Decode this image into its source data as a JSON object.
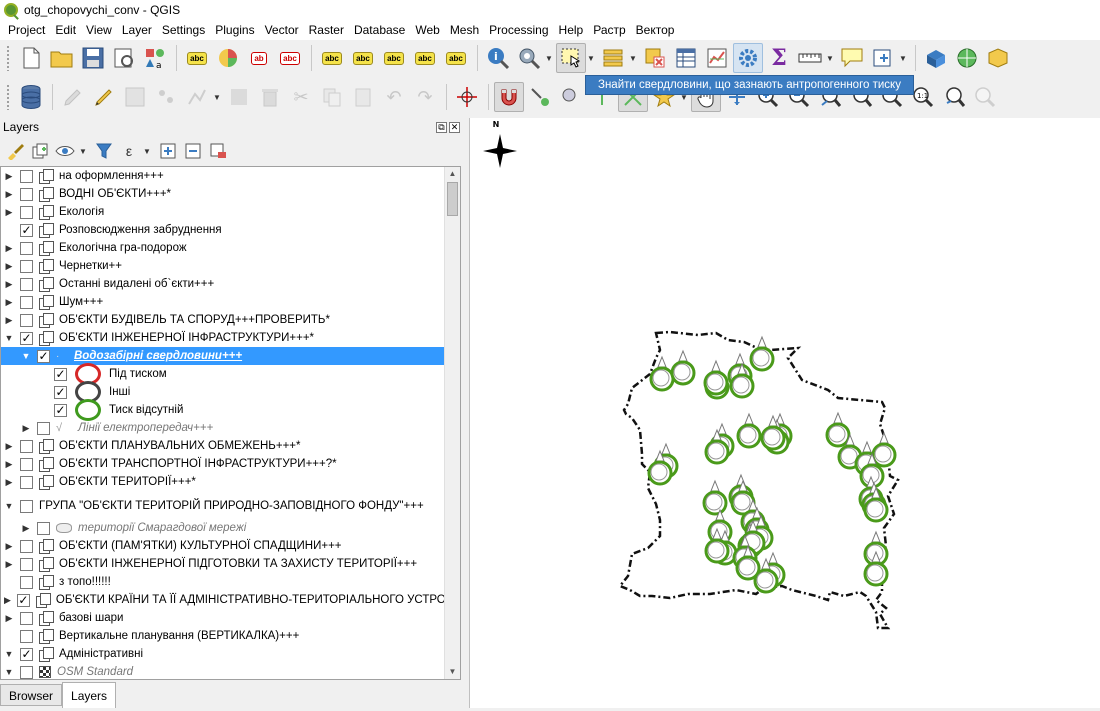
{
  "window": {
    "title": "otg_chopovychi_conv - QGIS"
  },
  "menubar": [
    {
      "label": "Project",
      "u": "P",
      "rest": "roject"
    },
    {
      "label": "Edit",
      "u": "E",
      "rest": "dit"
    },
    {
      "label": "View",
      "u": "V",
      "rest": "iew"
    },
    {
      "label": "Layer",
      "u": "L",
      "rest": "ayer"
    },
    {
      "label": "Settings",
      "u": "S",
      "rest": "ettings"
    },
    {
      "label": "Plugins",
      "u": "P",
      "rest": "lugins"
    },
    {
      "label": "Vector",
      "u": "V",
      "rest": "ector",
      "pre": "Vect",
      "post": "r",
      "mid": "o"
    },
    {
      "label": "Raster",
      "u": "R",
      "rest": "aster"
    },
    {
      "label": "Database",
      "u": "D",
      "rest": "atabase"
    },
    {
      "label": "Web",
      "u": "W",
      "rest": "eb"
    },
    {
      "label": "Mesh",
      "u": "M",
      "rest": "esh"
    },
    {
      "label": "Processing",
      "u": "o",
      "rest": "cessing",
      "pre": "Pr"
    },
    {
      "label": "Help",
      "u": "H",
      "rest": "elp"
    },
    {
      "label": "Растр",
      "u": "",
      "rest": "Растр"
    },
    {
      "label": "Вектор",
      "u": "",
      "rest": "Вектор"
    }
  ],
  "tooltip": {
    "text": "Знайти свердловини, що зазнають антропогенного тиску"
  },
  "layers_panel": {
    "title": "Layers",
    "tabs": [
      {
        "label": "Browser"
      },
      {
        "label": "Layers"
      }
    ],
    "tree": [
      {
        "label": "на оформлення+++",
        "checked": false,
        "expand": "collapsed",
        "indent": 0,
        "icon": "group"
      },
      {
        "label": "ВОДНІ ОБ'ЄКТИ+++*",
        "checked": false,
        "expand": "collapsed",
        "indent": 0,
        "icon": "group"
      },
      {
        "label": "Екологія",
        "checked": false,
        "expand": "collapsed",
        "indent": 0,
        "icon": "group"
      },
      {
        "label": "Розповсюдження забруднення",
        "checked": true,
        "expand": "none",
        "indent": 0,
        "icon": "group"
      },
      {
        "label": "Екологічна гра-подорож",
        "checked": false,
        "expand": "collapsed",
        "indent": 0,
        "icon": "group"
      },
      {
        "label": "Чернетки++",
        "checked": false,
        "expand": "collapsed",
        "indent": 0,
        "icon": "group"
      },
      {
        "label": "Останні видалені об`єкти+++",
        "checked": false,
        "expand": "collapsed",
        "indent": 0,
        "icon": "group"
      },
      {
        "label": "Шум+++",
        "checked": false,
        "expand": "collapsed",
        "indent": 0,
        "icon": "group"
      },
      {
        "label": "ОБ'ЄКТИ БУДІВЕЛЬ ТА СПОРУД+++ПРОВЕРИТЬ*",
        "checked": false,
        "expand": "collapsed",
        "indent": 0,
        "icon": "group"
      },
      {
        "label": "ОБ'ЄКТИ ІНЖЕНЕРНОЇ ІНФРАСТРУКТУРИ+++*",
        "checked": true,
        "expand": "expanded",
        "indent": 0,
        "icon": "group"
      },
      {
        "label": "Водозабірні свердловини+++",
        "checked": true,
        "expand": "expanded",
        "indent": 1,
        "icon": "point",
        "selected": true
      },
      {
        "label": "Під тиском",
        "checked": true,
        "expand": "none",
        "indent": 2,
        "icon": "ring",
        "color": "#d62828"
      },
      {
        "label": "Інші",
        "checked": true,
        "expand": "none",
        "indent": 2,
        "icon": "ring",
        "color": "#444444"
      },
      {
        "label": "Тиск відсутній",
        "checked": true,
        "expand": "none",
        "indent": 2,
        "icon": "ring",
        "color": "#3f9a1e"
      },
      {
        "label": "Лінії електропередач+++",
        "checked": false,
        "expand": "collapsed",
        "indent": 1,
        "icon": "line",
        "italic": true
      },
      {
        "label": "ОБ'ЄКТИ ПЛАНУВАЛЬНИХ ОБМЕЖЕНЬ+++*",
        "checked": false,
        "expand": "collapsed",
        "indent": 0,
        "icon": "group"
      },
      {
        "label": "ОБ'ЄКТИ ТРАНСПОРТНОЇ ІНФРАСТРУКТУРИ+++?*",
        "checked": false,
        "expand": "collapsed",
        "indent": 0,
        "icon": "group"
      },
      {
        "label": "ОБ'ЄКТИ ТЕРИТОРІЇ+++*",
        "checked": false,
        "expand": "collapsed",
        "indent": 0,
        "icon": "group"
      },
      {
        "label": "ГРУПА \"ОБ'ЄКТИ ТЕРИТОРІЙ ПРИРОДНО-ЗАПОВІДНОГО ФОНДУ\"+++",
        "checked": false,
        "expand": "expanded",
        "indent": 0,
        "icon": "none",
        "tall": true
      },
      {
        "label": "території Смарагдової мережі",
        "checked": false,
        "expand": "collapsed",
        "indent": 1,
        "icon": "polygon",
        "italic": true
      },
      {
        "label": "ОБ'ЄКТИ (ПАМ'ЯТКИ) КУЛЬТУРНОЇ СПАДЩИНИ+++",
        "checked": false,
        "expand": "collapsed",
        "indent": 0,
        "icon": "group"
      },
      {
        "label": "ОБ'ЄКТИ ІНЖЕНЕРНОЇ ПІДГОТОВКИ ТА ЗАХИСТУ ТЕРИТОРІЇ+++",
        "checked": false,
        "expand": "collapsed",
        "indent": 0,
        "icon": "group"
      },
      {
        "label": "з топо!!!!!!",
        "checked": false,
        "expand": "none",
        "indent": 0,
        "icon": "group"
      },
      {
        "label": "ОБ'ЄКТИ КРАЇНИ ТА ЇЇ АДМІНІСТРАТИВНО-ТЕРИТОРІАЛЬНОГО УСТРОЮ",
        "checked": true,
        "expand": "collapsed",
        "indent": 0,
        "icon": "group"
      },
      {
        "label": "базові шари",
        "checked": false,
        "expand": "collapsed",
        "indent": 0,
        "icon": "group"
      },
      {
        "label": "Вертикальне планування (ВЕРТИКАЛКА)+++",
        "checked": false,
        "expand": "none",
        "indent": 0,
        "icon": "group"
      },
      {
        "label": "Адміністративні",
        "checked": true,
        "expand": "expanded",
        "indent": 0,
        "icon": "group"
      },
      {
        "label": "OSM Standard",
        "checked": false,
        "expand": "expanded",
        "indent": 0,
        "icon": "raster",
        "italic": true
      }
    ]
  },
  "map": {
    "north_label": "N",
    "well_color": "#4a9a1a"
  }
}
